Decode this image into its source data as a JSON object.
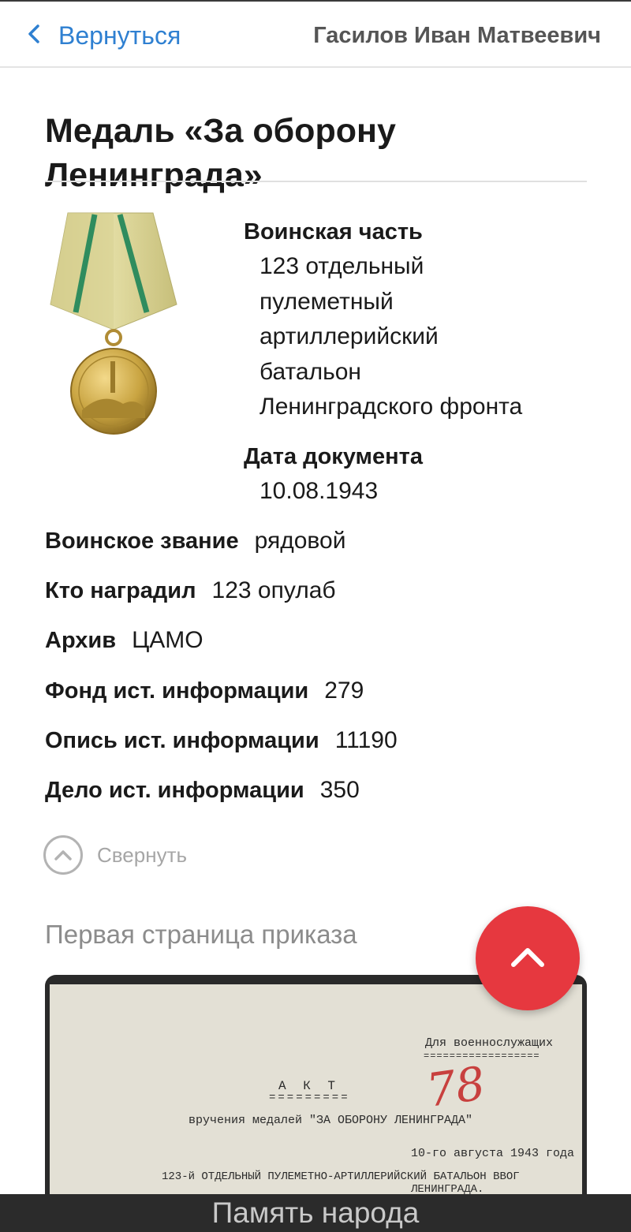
{
  "header": {
    "back_label": "Вернуться",
    "person_name": "Гасилов Иван Матвеевич"
  },
  "award": {
    "title": "Медаль «За оборону Ленинграда»",
    "medal_icon": "medal-leningrad-defense",
    "colors": {
      "ribbon": "#d6cf8e",
      "ribbon_stripe": "#2f8c5e",
      "medal_gold": "#c9a441"
    }
  },
  "details": {
    "unit_label": "Воинская часть",
    "unit_lines": [
      "123 отдельный",
      "пулеметный",
      "артиллерийский",
      "батальон",
      "Ленинградского фронта"
    ],
    "doc_date_label": "Дата документа",
    "doc_date": "10.08.1943",
    "rows": [
      {
        "label": "Воинское звание",
        "value": "рядовой"
      },
      {
        "label": "Кто наградил",
        "value": "123 опулаб"
      },
      {
        "label": "Архив",
        "value": "ЦАМО"
      },
      {
        "label": "Фонд ист. информации",
        "value": "279"
      },
      {
        "label": "Опись ист. информации",
        "value": "11190"
      },
      {
        "label": "Дело ист. информации",
        "value": "350"
      }
    ]
  },
  "collapse_label": "Свернуть",
  "order_section": {
    "title": "Первая страница приказа",
    "document": {
      "note": "Для военнослужащих",
      "heading": "А К Т",
      "subtitle": "вручения медалей \"ЗА ОБОРОНУ ЛЕНИНГРАДА\"",
      "date_line": "10-го августа 1943 года",
      "unit_line": "123-й ОТДЕЛЬНЫЙ ПУЛЕМЕТНО-АРТИЛЛЕРИЙСКИЙ БАТАЛЬОН ВВОГ",
      "unit_line2": "ЛЕНИНГРАДА.",
      "handwritten_number": "78"
    }
  },
  "footer": {
    "brand": "Память народа"
  },
  "accent_colors": {
    "link": "#2f80d1",
    "fab": "#e6383f"
  }
}
